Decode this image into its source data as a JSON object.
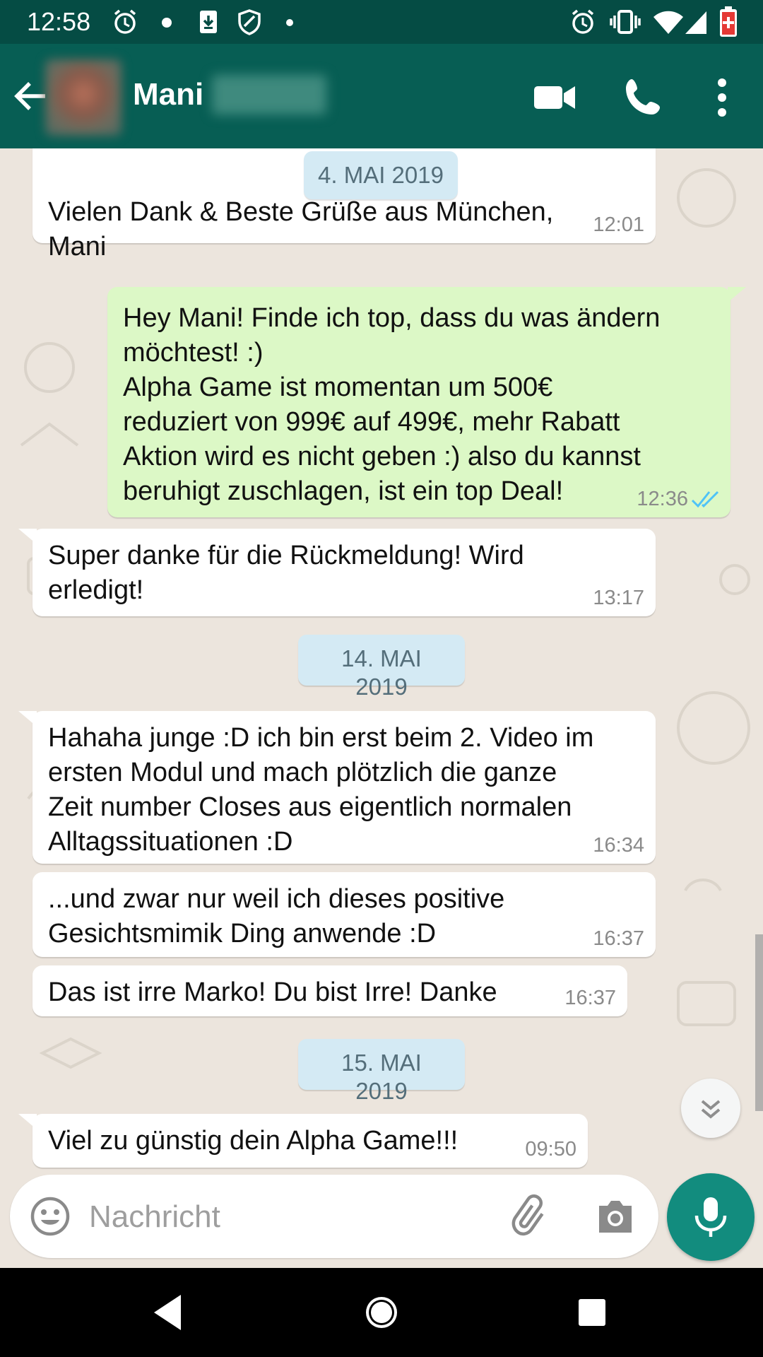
{
  "status_bar": {
    "time": "12:58",
    "left_icons": [
      "alarm-icon",
      "dot-icon",
      "download-icon",
      "shield-icon",
      "dot-icon"
    ],
    "right_icons": [
      "alarm-icon",
      "vibrate-icon",
      "wifi-icon",
      "signal-icon",
      "battery-icon"
    ]
  },
  "header": {
    "contact_name": "Mani",
    "icons": [
      "back-arrow-icon",
      "video-call-icon",
      "phone-icon",
      "more-vert-icon"
    ]
  },
  "messages": [
    {
      "type": "incoming",
      "text": "Vielen Dank & Beste Grüße aus München,\nMani",
      "time": "12:01"
    },
    {
      "type": "outgoing",
      "text": "Hey Mani! Finde ich top, dass du was ändern\nmöchtest! :)\nAlpha Game ist momentan um 500€\nreduziert von 999€ auf 499€, mehr Rabatt\nAktion wird es nicht geben :) also du kannst\nberuhigt zuschlagen, ist ein top Deal!",
      "time": "12:36",
      "status": "read"
    },
    {
      "type": "incoming",
      "text": "Super danke für die Rückmeldung! Wird\nerledigt!",
      "time": "13:17"
    },
    {
      "type": "incoming",
      "text": "Hahaha junge :D ich bin erst beim 2. Video im\nersten Modul und mach plötzlich die ganze\nZeit number Closes aus eigentlich normalen\nAlltagssituationen :D",
      "time": "16:34"
    },
    {
      "type": "incoming",
      "text": "...und zwar nur weil ich dieses positive\nGesichtsmimik Ding anwende :D",
      "time": "16:37"
    },
    {
      "type": "incoming",
      "text": "Das ist irre Marko! Du bist Irre! Danke",
      "time": "16:37"
    },
    {
      "type": "incoming",
      "text": "Viel zu günstig dein Alpha Game!!!",
      "time": "09:50"
    }
  ],
  "date_chips": [
    "4. MAI 2019",
    "14. MAI 2019",
    "15. MAI 2019"
  ],
  "input": {
    "placeholder": "Nachricht",
    "icons": [
      "emoji-icon",
      "attach-icon",
      "camera-icon",
      "mic-icon"
    ]
  },
  "nav_bar": {
    "icons": [
      "nav-back-icon",
      "nav-home-icon",
      "nav-recents-icon"
    ]
  },
  "colors": {
    "status_bar": "#054c44",
    "app_bar": "#075e54",
    "chat_bg": "#ece5dd",
    "bubble_in": "#ffffff",
    "bubble_out": "#dcf8c6",
    "date_chip": "#d4eaf4",
    "read_ticks": "#4fc3f7",
    "accent": "#128c7e"
  }
}
